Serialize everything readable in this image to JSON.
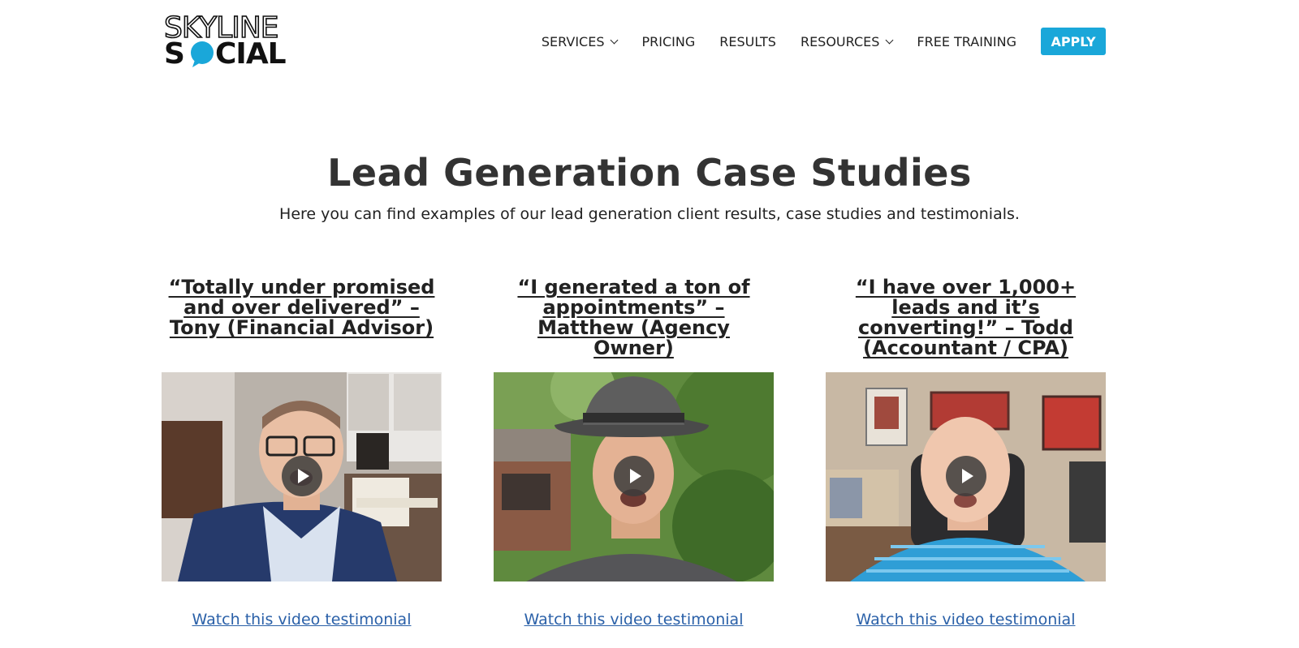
{
  "header": {
    "logo_text": "SKYLINE SOCIAL",
    "nav": [
      {
        "label": "SERVICES",
        "has_dropdown": true
      },
      {
        "label": "PRICING",
        "has_dropdown": false
      },
      {
        "label": "RESULTS",
        "has_dropdown": false
      },
      {
        "label": "RESOURCES",
        "has_dropdown": true
      },
      {
        "label": "FREE TRAINING",
        "has_dropdown": false
      }
    ],
    "apply_label": "APPLY",
    "brand_color": "#1aa7d9"
  },
  "hero": {
    "title": "Lead Generation Case Studies",
    "subtitle": "Here you can find examples of our lead generation client results, case studies and testimonials."
  },
  "cards": [
    {
      "quote": "“Totally under promised and over delivered” – Tony (Financial Advisor)",
      "video_icon": "play-icon",
      "link": "Watch this video testimonial"
    },
    {
      "quote": "“I generated a ton of appointments” – Matthew (Agency Owner)",
      "video_icon": "play-icon",
      "link": "Watch this video testimonial"
    },
    {
      "quote": "“I have over 1,000+ leads and it’s converting!” – Todd (Accountant / CPA)",
      "video_icon": "play-icon",
      "link": "Watch this video testimonial"
    }
  ],
  "colors": {
    "link": "#2a60a8",
    "heading": "#333333"
  }
}
